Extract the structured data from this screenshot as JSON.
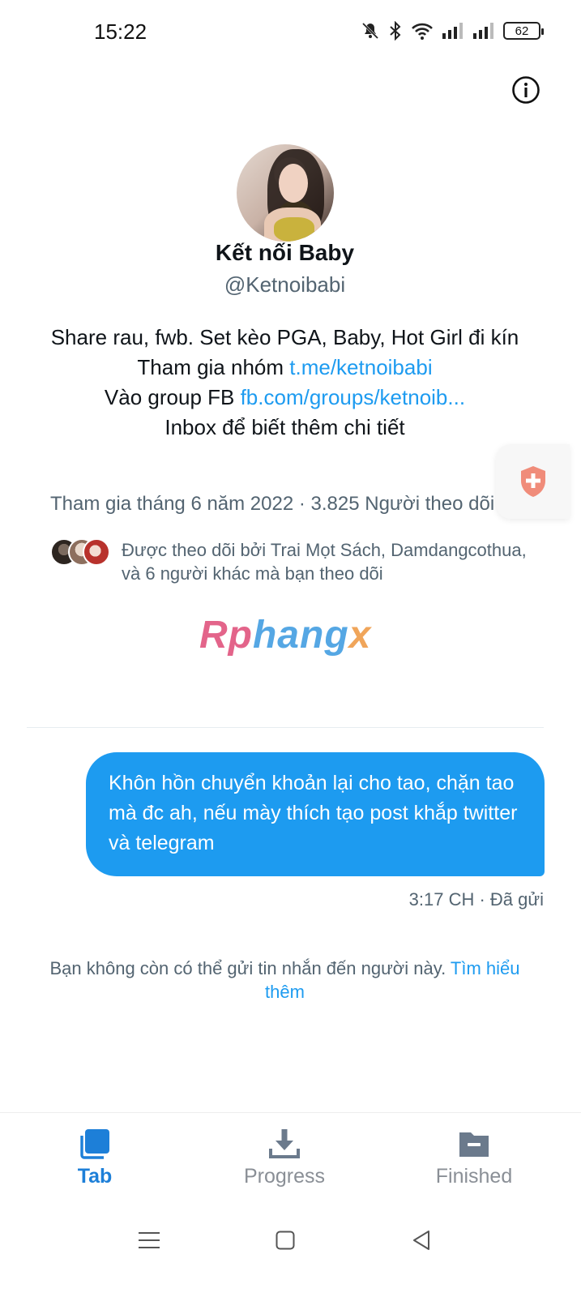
{
  "status_bar": {
    "time": "15:22",
    "battery": "62",
    "icons": [
      "mute-bell-icon",
      "bluetooth-icon",
      "wifi-icon",
      "signal-icon",
      "signal-icon"
    ]
  },
  "profile": {
    "display_name": "Kết nối Baby",
    "handle": "@Ketnoibabi",
    "bio_line1": "Share rau, fwb. Set kèo PGA, Baby, Hot Girl đi kín",
    "bio_line2_text": "Tham gia nhóm ",
    "bio_line2_link": "t.me/ketnoibabi",
    "bio_line3_text": "Vào group FB ",
    "bio_line3_link": "fb.com/groups/ketnoib...",
    "bio_line4": "Inbox để biết thêm chi tiết",
    "joined": "Tham gia tháng 6 năm 2022 · 3.825 Người theo dõi",
    "followed_by": "Được theo dõi bởi Trai Mọt Sách, Damdangcothua, và 6 người khác mà bạn theo dõi"
  },
  "watermark": {
    "part1": "Rp",
    "part2": "hang",
    "part3": "x"
  },
  "message": {
    "text": "Khôn hồn chuyển khoản lại cho tao, chặn tao mà đc ah, nếu mày thích tạo post khắp twitter và telegram",
    "meta": "3:17 CH · Đã gửi"
  },
  "notice": {
    "text": "Bạn không còn có thể gửi tin nhắn đến người này. ",
    "link": "Tìm hiểu thêm"
  },
  "bottom_nav": {
    "tab": "Tab",
    "progress": "Progress",
    "finished": "Finished"
  },
  "colors": {
    "accent": "#1d9bf0",
    "muted": "#536471",
    "nav_active": "#1d7fd8"
  }
}
